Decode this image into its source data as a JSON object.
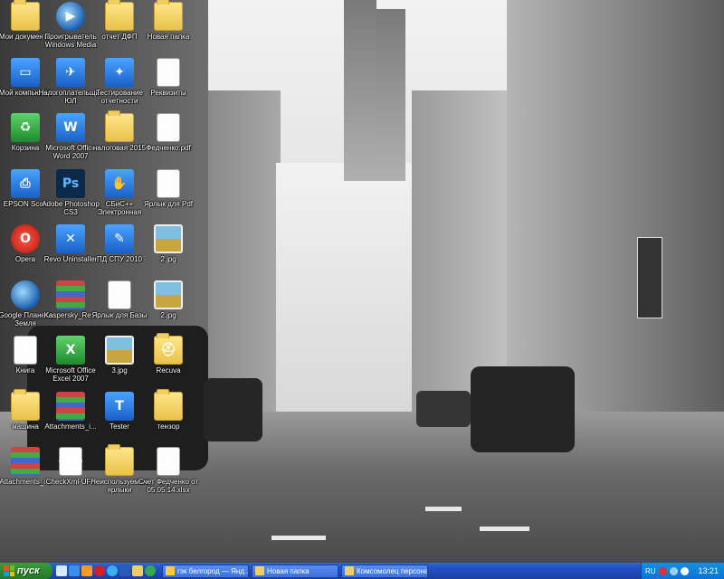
{
  "desktop": {
    "icons": [
      {
        "label": "Мои документы",
        "icon": "folder-icon"
      },
      {
        "label": "Проигрыватель Windows Media",
        "icon": "media-player-icon"
      },
      {
        "label": "отчет ДФП",
        "icon": "folder-icon"
      },
      {
        "label": "Новая папка",
        "icon": "folder-icon"
      },
      {
        "label": "Мой компьютер",
        "icon": "computer-icon"
      },
      {
        "label": "Налогоплательщик ЮЛ",
        "icon": "tax-app-icon"
      },
      {
        "label": "Тестирование отчетности",
        "icon": "test-icon"
      },
      {
        "label": "Реквизиты",
        "icon": "document-icon"
      },
      {
        "label": "Корзина",
        "icon": "recycle-bin-icon"
      },
      {
        "label": "Microsoft Office Word 2007",
        "icon": "word-icon"
      },
      {
        "label": "налоговая 2015",
        "icon": "folder-icon"
      },
      {
        "label": "Федченко.pdf",
        "icon": "pdf-icon"
      },
      {
        "label": "EPSON Scan",
        "icon": "scanner-icon"
      },
      {
        "label": "Adobe Photoshop CS3",
        "icon": "photoshop-icon"
      },
      {
        "label": "СБиС++ Электронная отчетность",
        "icon": "sbis-icon"
      },
      {
        "label": "Ярлык для Pdf",
        "icon": "shortcut-icon"
      },
      {
        "label": "Opera",
        "icon": "opera-icon"
      },
      {
        "label": "Revo Uninstaller",
        "icon": "uninstaller-icon"
      },
      {
        "label": "ПД СПУ 2010",
        "icon": "pdspu-icon"
      },
      {
        "label": "2.jpg",
        "icon": "image-icon"
      },
      {
        "label": "Google Планета Земля",
        "icon": "google-earth-icon"
      },
      {
        "label": "Kaspersky_Re...",
        "icon": "archive-icon"
      },
      {
        "label": "Ярлык для Базы",
        "icon": "shortcut-icon"
      },
      {
        "label": "2.jpg",
        "icon": "image-icon"
      },
      {
        "label": "Книга",
        "icon": "book-icon"
      },
      {
        "label": "Microsoft Office Excel 2007",
        "icon": "excel-icon"
      },
      {
        "label": "3.jpg",
        "icon": "image-icon"
      },
      {
        "label": "Recuva",
        "icon": "recuva-icon"
      },
      {
        "label": "машина",
        "icon": "folder-icon"
      },
      {
        "label": "Attachments_i...",
        "icon": "archive-icon"
      },
      {
        "label": "Tester",
        "icon": "tester-icon"
      },
      {
        "label": "тензор",
        "icon": "folder-icon"
      },
      {
        "label": "Attachments_i...",
        "icon": "archive-icon"
      },
      {
        "label": "CheckXml-UFA",
        "icon": "xml-icon"
      },
      {
        "label": "Неиспользуемые ярлыки",
        "icon": "folder-icon"
      },
      {
        "label": "Счет Федченко от 05.05.14.xlsx",
        "icon": "excel-file-icon"
      }
    ]
  },
  "taskbar": {
    "start_label": "пуск",
    "tasks": [
      {
        "label": "гэк белгород — Янд...",
        "icon": "browser-icon"
      },
      {
        "label": "Новая папка",
        "icon": "folder-icon"
      },
      {
        "label": "Комсомолец персона...",
        "icon": "folder-icon"
      }
    ],
    "tray": {
      "language": "RU",
      "clock": "13:21"
    }
  },
  "colors": {
    "taskbar": "#245edb",
    "start": "#2f8a2f",
    "tray": "#0c72d8"
  }
}
